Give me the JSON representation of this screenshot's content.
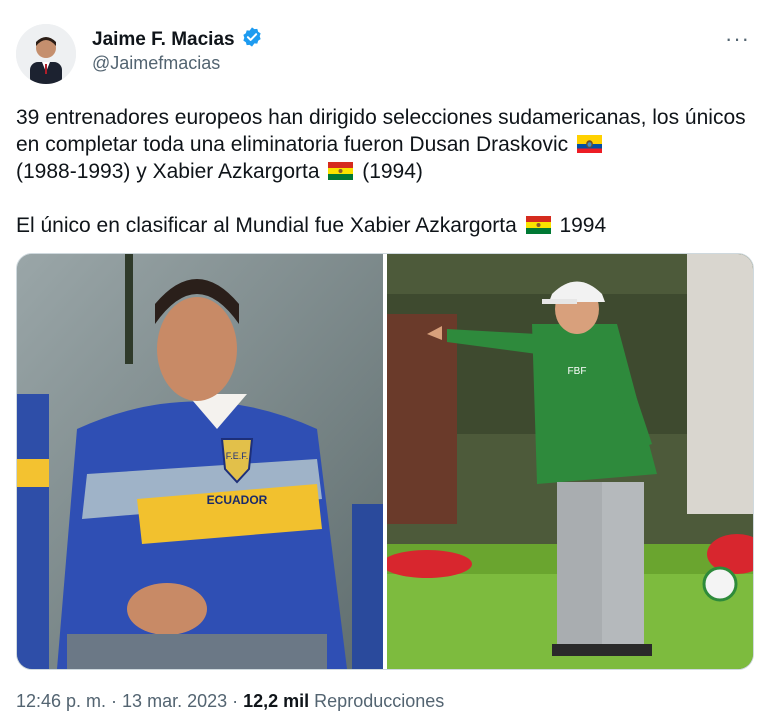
{
  "author": {
    "name": "Jaime F. Macias",
    "handle": "@Jaimefmacias",
    "verified": true
  },
  "tweet": {
    "line1_part1": "39 entrenadores europeos han dirigido selecciones sudamericanas, los únicos en completar toda una eliminatoria fueron Dusan Draskovic",
    "line1_part2": "(1988-1993) y Xabier Azkargorta",
    "line1_part3": "(1994)",
    "line2_part1": "El único en clasificar al Mundial fue Xabier Azkargorta",
    "line2_part2": "1994"
  },
  "media": {
    "left_jersey_text": "F.E.F.",
    "left_jersey_word": "ECUADOR",
    "right_jacket_text": "FBF"
  },
  "meta": {
    "time_date": "12:46 p. m. · 13 mar. 2023 · ",
    "views_count": "12,2 mil",
    "views_label": " Reproducciones"
  },
  "colors": {
    "verified_blue": "#1d9bf0",
    "text_secondary": "#536471"
  }
}
